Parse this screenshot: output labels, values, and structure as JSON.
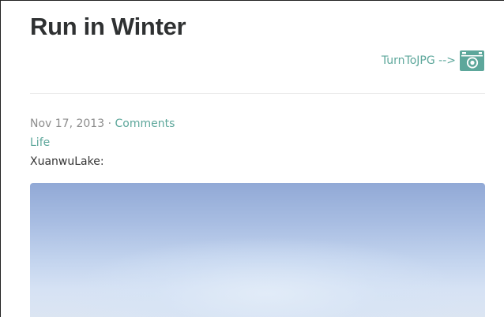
{
  "post": {
    "title": "Run in Winter",
    "export_label": "TurnToJPG -->",
    "export_icon": "camera-icon",
    "date": "Nov 17, 2013",
    "separator": "·",
    "comments_label": "Comments",
    "category": "Life",
    "body_text": "XuanwuLake:"
  },
  "colors": {
    "accent": "#5da79b",
    "title": "#2f3132",
    "meta": "#8c8c8c"
  }
}
